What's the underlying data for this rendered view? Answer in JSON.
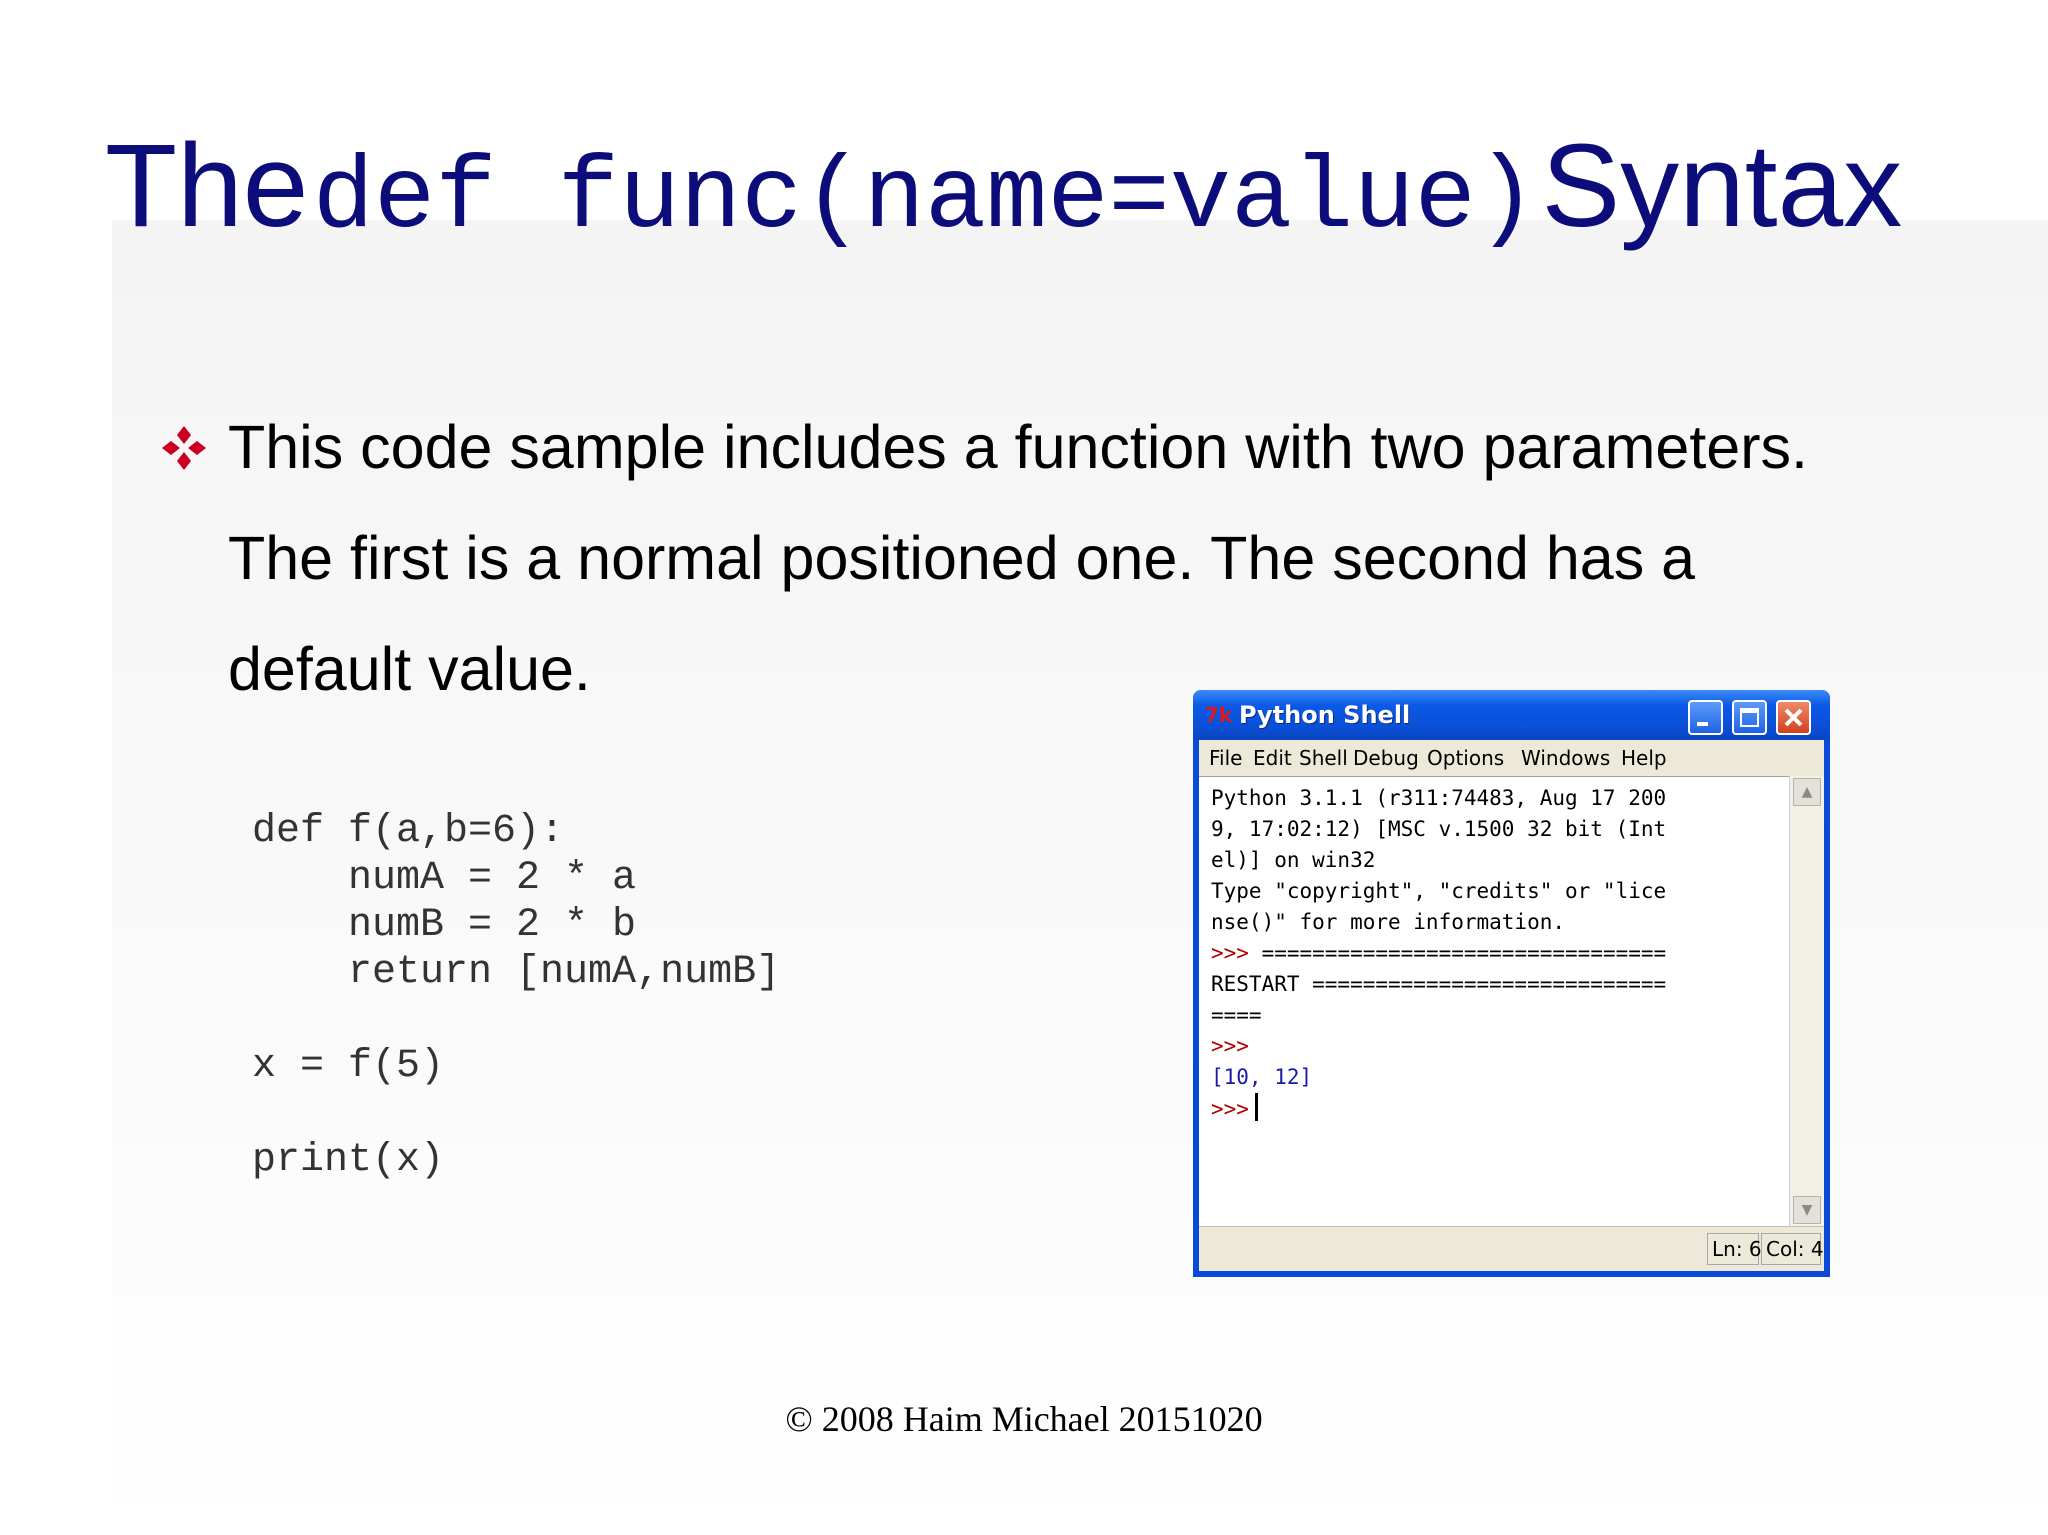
{
  "slide": {
    "title": {
      "prefix": "The",
      "code": "def func(name=value)",
      "suffix": "Syntax"
    },
    "bullet": {
      "icon": "diamond-quad-icon",
      "text": "This code sample includes a function with two parameters. The first is a normal positioned one. The second has a default value."
    },
    "code_sample": "def f(a,b=6):\n    numA = 2 * a\n    numB = 2 * b\n    return [numA,numB]\n\nx = f(5)\n\nprint(x)",
    "footer": "© 2008 Haim Michael 20151020"
  },
  "window": {
    "title": "Python Shell",
    "icon": "idle-logo-icon",
    "menu": [
      "File",
      "Edit",
      "Shell",
      "Debug",
      "Options",
      "Windows",
      "Help"
    ],
    "shell_lines": [
      "Python 3.1.1 (r311:74483, Aug 17 200",
      "9, 17:02:12) [MSC v.1500 32 bit (Int",
      "el)] on win32",
      "Type \"copyright\", \"credits\" or \"lice",
      "nse()\" for more information."
    ],
    "restart_line_1": "================================",
    "restart_line_2": "RESTART ============================",
    "restart_line_3": "====",
    "prompt": ">>>",
    "output": "[10, 12]",
    "status": {
      "ln": "Ln: 6",
      "col": "Col: 4"
    }
  },
  "colors": {
    "title": "#0c0c7a",
    "bullet": "#c8001e",
    "prompt": "#b00000",
    "output": "#1a1aaa"
  }
}
